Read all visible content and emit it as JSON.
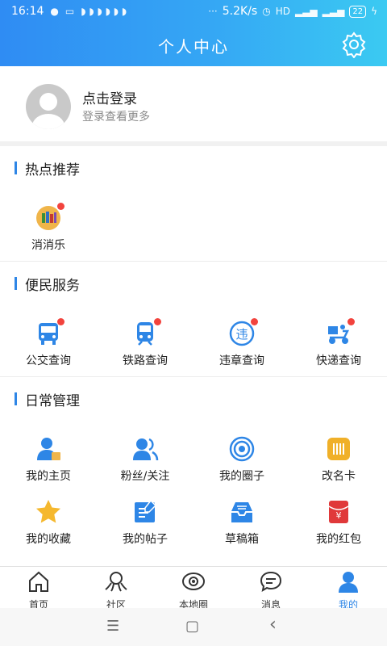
{
  "status_bar": {
    "time": "16:14",
    "net_speed": "5.2K/s",
    "hd": "HD",
    "battery": "22"
  },
  "header": {
    "title": "个人中心"
  },
  "login": {
    "title": "点击登录",
    "subtitle": "登录查看更多"
  },
  "sections": {
    "hot": {
      "title": "热点推荐",
      "items": [
        {
          "label": "消消乐"
        }
      ]
    },
    "service": {
      "title": "便民服务",
      "items": [
        {
          "label": "公交查询"
        },
        {
          "label": "铁路查询"
        },
        {
          "label": "违章查询"
        },
        {
          "label": "快递查询"
        }
      ]
    },
    "daily": {
      "title": "日常管理",
      "items": [
        {
          "label": "我的主页"
        },
        {
          "label": "粉丝/关注"
        },
        {
          "label": "我的圈子"
        },
        {
          "label": "改名卡"
        },
        {
          "label": "我的收藏"
        },
        {
          "label": "我的帖子"
        },
        {
          "label": "草稿箱"
        },
        {
          "label": "我的红包"
        }
      ]
    }
  },
  "tabs": [
    {
      "label": "首页"
    },
    {
      "label": "社区"
    },
    {
      "label": "本地圈"
    },
    {
      "label": "消息"
    },
    {
      "label": "我的"
    }
  ],
  "colors": {
    "accent": "#2e86e6",
    "header_start": "#2f8cf3",
    "header_end": "#3bcaf2",
    "badge": "#f2433d"
  },
  "nav": {
    "menu": "☰",
    "home": "▢",
    "back": "‹"
  }
}
